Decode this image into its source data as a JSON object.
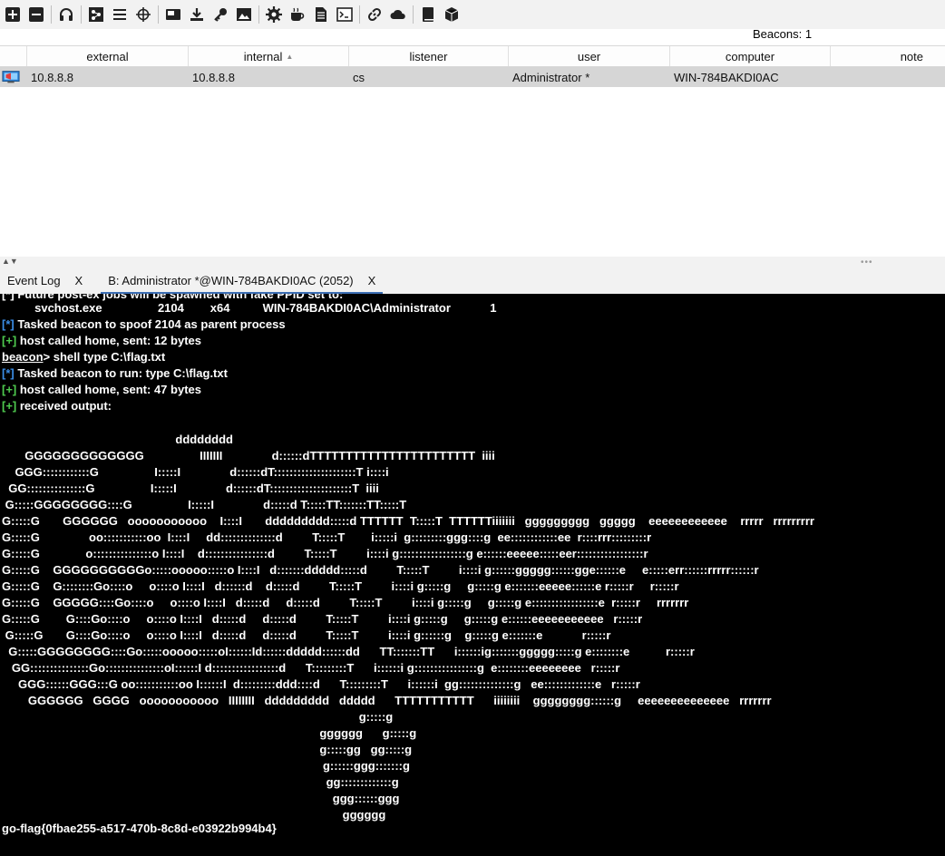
{
  "toolbar": {
    "buttons": [
      "new-connection-icon",
      "disconnect-icon",
      "headphones-icon",
      "listeners-icon",
      "list-icon",
      "target-icon",
      "screenshot-icon",
      "download-icon",
      "key-icon",
      "image-icon",
      "settings-icon",
      "coffee-icon",
      "document-icon",
      "terminal-icon",
      "link-icon",
      "cloud-icon",
      "book-icon",
      "package-icon"
    ]
  },
  "beacons_label": "Beacons: 1",
  "table": {
    "columns": [
      "external",
      "internal",
      "listener",
      "user",
      "computer",
      "note"
    ],
    "rows": [
      {
        "external": "10.8.8.8",
        "internal": "10.8.8.8",
        "listener": "cs",
        "user": "Administrator *",
        "computer": "WIN-784BAKDI0AC",
        "note": ""
      }
    ]
  },
  "tabs": [
    {
      "label": "Event Log",
      "close": "X"
    },
    {
      "label": "B: Administrator *@WIN-784BAKDI0AC (2052)",
      "close": "X"
    }
  ],
  "console": {
    "line0": "[*] Future post-ex jobs will be spawned with fake PPID set to:",
    "ps_row": "          svchost.exe                 2104        x64          WIN-784BAKDI0AC\\Administrator            1",
    "l1_pfx": "[*]",
    "l1": " Tasked beacon to spoof 2104 as parent process",
    "l2_pfx": "[+]",
    "l2": " host called home, sent: 12 bytes",
    "prompt": "beacon",
    "cmd": "> shell type C:\\flag.txt",
    "l3_pfx": "[*]",
    "l3": " Tasked beacon to run: type C:\\flag.txt",
    "l4_pfx": "[+]",
    "l4": " host called home, sent: 47 bytes",
    "l5_pfx": "[+]",
    "l5": " received output:",
    "ascii_art": "                                                     dddddddd\n       GGGGGGGGGGGGG                 IIIIIII               d::::::dTTTTTTTTTTTTTTTTTTTTTTT  iiii\n    GGG::::::::::::G                 I:::::I               d::::::dT:::::::::::::::::::::T i::::i\n  GG:::::::::::::::G                 I:::::I               d::::::dT:::::::::::::::::::::T  iiii\n G:::::GGGGGGGG::::G                 I:::::I               d:::::d T:::::TT:::::::TT:::::T\nG:::::G       GGGGGG   ooooooooooo    I::::I       ddddddddd:::::d TTTTTT  T:::::T  TTTTTTiiiiiii   ggggggggg   ggggg    eeeeeeeeeeee    rrrrr   rrrrrrrrr\nG:::::G               oo:::::::::::oo  I::::I     dd::::::::::::::d         T:::::T        i:::::i  g:::::::::ggg::::g  ee::::::::::::ee  r::::rrr:::::::::r\nG:::::G              o:::::::::::::::o I::::I    d::::::::::::::::d         T:::::T         i::::i g:::::::::::::::::g e::::::eeeee:::::eer:::::::::::::::::r\nG:::::G    GGGGGGGGGGo:::::ooooo:::::o I::::I   d:::::::ddddd:::::d         T:::::T         i::::i g::::::ggggg::::::gge::::::e     e:::::err::::::rrrrr::::::r\nG:::::G    G::::::::Go::::o     o::::o I::::I   d::::::d    d:::::d         T:::::T         i::::i g:::::g     g:::::g e:::::::eeeee::::::e r:::::r     r:::::r\nG:::::G    GGGGG::::Go::::o     o::::o I::::I   d:::::d     d:::::d         T:::::T         i::::i g:::::g     g:::::g e:::::::::::::::::e  r:::::r     rrrrrrr\nG:::::G        G::::Go::::o     o::::o I::::I   d:::::d     d:::::d         T:::::T         i::::i g:::::g     g:::::g e::::::eeeeeeeeeee   r:::::r\n G:::::G       G::::Go::::o     o::::o I::::I   d:::::d     d:::::d         T:::::T         i::::i g::::::g    g:::::g e:::::::e            r:::::r\n  G:::::GGGGGGGG::::Go:::::ooooo:::::oI::::::Id::::::ddddd::::::dd      TT:::::::TT      i::::::ig:::::::ggggg:::::g e::::::::e           r:::::r\n   GG:::::::::::::::Go:::::::::::::::oI::::::I d:::::::::::::::::d      T:::::::::T      i::::::i g::::::::::::::::g  e::::::::eeeeeeee   r:::::r\n     GGG::::::GGG:::G oo:::::::::::oo I::::::I  d:::::::::ddd::::d      T:::::::::T      i::::::i  gg::::::::::::::g   ee:::::::::::::e   r:::::r\n        GGGGGG   GGGG   ooooooooooo   IIIIIIII   ddddddddd   ddddd      TTTTTTTTTTT      iiiiiiii    gggggggg::::::g     eeeeeeeeeeeeee   rrrrrrr\n                                                                                                             g:::::g\n                                                                                                 gggggg      g:::::g\n                                                                                                 g:::::gg   gg:::::g\n                                                                                                  g::::::ggg:::::::g\n                                                                                                   gg:::::::::::::g\n                                                                                                     ggg::::::ggg\n                                                                                                        gggggg",
    "flag": "go-flag{0fbae255-a517-470b-8c8d-e03922b994b4}"
  }
}
